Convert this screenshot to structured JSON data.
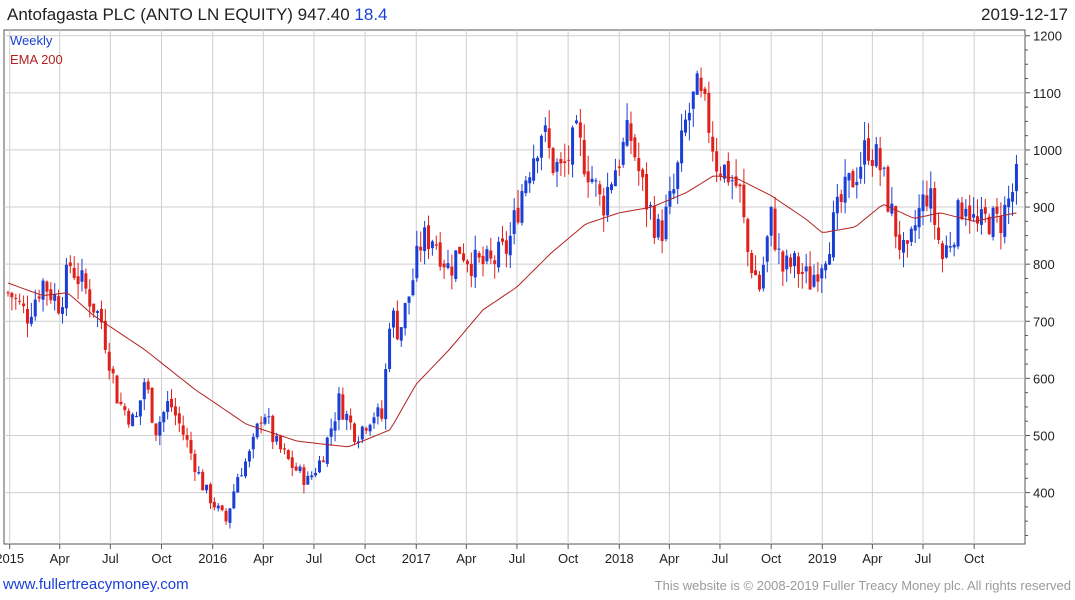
{
  "header": {
    "title": "Antofagasta PLC (ANTO LN EQUITY) 947.40",
    "change": "18.4",
    "date": "2019-12-17"
  },
  "footer": {
    "website": "www.fullertreacymoney.com",
    "copyright": "This website is © 2008-2019 Fuller Treacy Money plc. All rights reserved"
  },
  "colors": {
    "up": "#1a3fd6",
    "down": "#e0201a",
    "ema": "#b22222",
    "grid": "#cfcfcf",
    "axis": "#555555",
    "legend_weekly": "#1a3fd6",
    "legend_ema": "#b22222"
  },
  "chart_data": {
    "type": "candlestick",
    "frequency": "weekly",
    "legend": [
      "Weekly",
      "EMA 200"
    ],
    "ylim": [
      310,
      1210
    ],
    "y_ticks": [
      400,
      500,
      600,
      700,
      800,
      900,
      1000,
      1100,
      1200
    ],
    "y_axis_side": "right",
    "x_start": "2014-12-29",
    "x_end": "2019-12-17",
    "x_ticks": [
      {
        "label": "2015",
        "date": "2015-01-01"
      },
      {
        "label": "Apr",
        "date": "2015-04-01"
      },
      {
        "label": "Jul",
        "date": "2015-07-01"
      },
      {
        "label": "Oct",
        "date": "2015-10-01"
      },
      {
        "label": "2016",
        "date": "2016-01-01"
      },
      {
        "label": "Apr",
        "date": "2016-04-01"
      },
      {
        "label": "Jul",
        "date": "2016-07-01"
      },
      {
        "label": "Oct",
        "date": "2016-10-01"
      },
      {
        "label": "2017",
        "date": "2017-01-01"
      },
      {
        "label": "Apr",
        "date": "2017-04-01"
      },
      {
        "label": "Jul",
        "date": "2017-07-01"
      },
      {
        "label": "Oct",
        "date": "2017-10-01"
      },
      {
        "label": "2018",
        "date": "2018-01-01"
      },
      {
        "label": "Apr",
        "date": "2018-04-01"
      },
      {
        "label": "Jul",
        "date": "2018-07-01"
      },
      {
        "label": "Oct",
        "date": "2018-10-01"
      },
      {
        "label": "2019",
        "date": "2019-01-01"
      },
      {
        "label": "Apr",
        "date": "2019-04-01"
      },
      {
        "label": "Jul",
        "date": "2019-07-01"
      },
      {
        "label": "Oct",
        "date": "2019-10-01"
      }
    ],
    "close_path": [
      [
        "2015-01-01",
        750
      ],
      [
        "2015-02-01",
        710
      ],
      [
        "2015-03-01",
        770
      ],
      [
        "2015-04-01",
        730
      ],
      [
        "2015-04-20",
        800
      ],
      [
        "2015-05-15",
        760
      ],
      [
        "2015-06-15",
        700
      ],
      [
        "2015-07-15",
        560
      ],
      [
        "2015-08-15",
        520
      ],
      [
        "2015-09-01",
        600
      ],
      [
        "2015-09-20",
        510
      ],
      [
        "2015-10-15",
        560
      ],
      [
        "2015-11-15",
        490
      ],
      [
        "2015-12-15",
        410
      ],
      [
        "2016-01-10",
        370
      ],
      [
        "2016-01-25",
        350
      ],
      [
        "2016-02-15",
        430
      ],
      [
        "2016-03-10",
        470
      ],
      [
        "2016-04-01",
        550
      ],
      [
        "2016-04-20",
        490
      ],
      [
        "2016-05-20",
        450
      ],
      [
        "2016-06-20",
        420
      ],
      [
        "2016-07-15",
        460
      ],
      [
        "2016-08-15",
        560
      ],
      [
        "2016-09-15",
        500
      ],
      [
        "2016-10-15",
        540
      ],
      [
        "2016-11-01",
        530
      ],
      [
        "2016-11-15",
        720
      ],
      [
        "2016-12-01",
        680
      ],
      [
        "2016-12-20",
        750
      ],
      [
        "2017-01-10",
        840
      ],
      [
        "2017-02-01",
        850
      ],
      [
        "2017-03-01",
        790
      ],
      [
        "2017-03-20",
        830
      ],
      [
        "2017-04-15",
        800
      ],
      [
        "2017-05-15",
        800
      ],
      [
        "2017-06-15",
        830
      ],
      [
        "2017-07-15",
        950
      ],
      [
        "2017-08-15",
        1040
      ],
      [
        "2017-09-01",
        980
      ],
      [
        "2017-09-20",
        960
      ],
      [
        "2017-10-15",
        1020
      ],
      [
        "2017-11-10",
        960
      ],
      [
        "2017-12-01",
        900
      ],
      [
        "2017-12-20",
        960
      ],
      [
        "2018-01-20",
        1030
      ],
      [
        "2018-02-15",
        920
      ],
      [
        "2018-03-15",
        850
      ],
      [
        "2018-04-10",
        930
      ],
      [
        "2018-05-01",
        1050
      ],
      [
        "2018-05-20",
        1100
      ],
      [
        "2018-06-10",
        1050
      ],
      [
        "2018-06-25",
        980
      ],
      [
        "2018-07-15",
        960
      ],
      [
        "2018-08-05",
        930
      ],
      [
        "2018-08-20",
        820
      ],
      [
        "2018-09-10",
        760
      ],
      [
        "2018-10-01",
        880
      ],
      [
        "2018-10-20",
        790
      ],
      [
        "2018-11-10",
        800
      ],
      [
        "2018-12-10",
        770
      ],
      [
        "2019-01-05",
        820
      ],
      [
        "2019-02-01",
        900
      ],
      [
        "2019-03-01",
        960
      ],
      [
        "2019-03-25",
        1010
      ],
      [
        "2019-04-15",
        970
      ],
      [
        "2019-05-10",
        870
      ],
      [
        "2019-06-01",
        800
      ],
      [
        "2019-06-20",
        880
      ],
      [
        "2019-07-10",
        930
      ],
      [
        "2019-08-05",
        810
      ],
      [
        "2019-08-25",
        860
      ],
      [
        "2019-09-15",
        920
      ],
      [
        "2019-10-05",
        860
      ],
      [
        "2019-10-25",
        880
      ],
      [
        "2019-11-15",
        870
      ],
      [
        "2019-12-02",
        910
      ],
      [
        "2019-12-17",
        947
      ]
    ],
    "ema_path": [
      [
        "2014-12-29",
        767
      ],
      [
        "2015-03-01",
        745
      ],
      [
        "2015-04-15",
        750
      ],
      [
        "2015-06-01",
        710
      ],
      [
        "2015-09-01",
        650
      ],
      [
        "2015-12-01",
        580
      ],
      [
        "2016-03-01",
        520
      ],
      [
        "2016-06-01",
        490
      ],
      [
        "2016-09-01",
        480
      ],
      [
        "2016-11-15",
        510
      ],
      [
        "2017-01-01",
        590
      ],
      [
        "2017-03-01",
        650
      ],
      [
        "2017-05-01",
        720
      ],
      [
        "2017-07-01",
        760
      ],
      [
        "2017-09-01",
        820
      ],
      [
        "2017-11-01",
        870
      ],
      [
        "2018-01-01",
        890
      ],
      [
        "2018-03-01",
        900
      ],
      [
        "2018-05-01",
        925
      ],
      [
        "2018-06-20",
        955
      ],
      [
        "2018-08-01",
        950
      ],
      [
        "2018-10-01",
        920
      ],
      [
        "2018-12-01",
        880
      ],
      [
        "2019-01-01",
        855
      ],
      [
        "2019-03-01",
        865
      ],
      [
        "2019-04-20",
        905
      ],
      [
        "2019-06-15",
        880
      ],
      [
        "2019-08-01",
        890
      ],
      [
        "2019-10-01",
        875
      ],
      [
        "2019-12-17",
        890
      ]
    ]
  }
}
